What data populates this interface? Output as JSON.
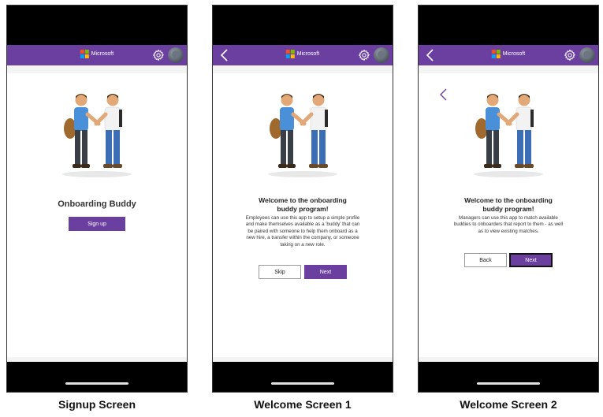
{
  "brand": {
    "name": "Microsoft",
    "logo_colors": [
      "#f25022",
      "#7fba00",
      "#00a4ef",
      "#ffb900"
    ]
  },
  "colors": {
    "header": "#6a3fa0",
    "primary_button": "#6a3fa0"
  },
  "icons": {
    "back": "back-arrow-icon",
    "settings": "gear-icon",
    "profile": "avatar"
  },
  "screens": [
    {
      "caption": "Signup Screen",
      "app_title": "Onboarding Buddy",
      "primary_button": "Sign up"
    },
    {
      "caption": "Welcome Screen 1",
      "title": "Welcome to the onboarding buddy program!",
      "body": "Employees can use this app to setup a simple profile and make themselves available as a 'buddy' that can be paired with someone to help them onboard as a new hire, a transfer within the company, or someone taking on a new role.",
      "secondary_button": "Skip",
      "primary_button": "Next"
    },
    {
      "caption": "Welcome Screen 2",
      "title": "Welcome to the onboarding buddy program!",
      "body": "Managers can use this app to match available buddies to onboarders that report to them - as well as to view existing matches.",
      "secondary_button": "Back",
      "primary_button": "Next"
    }
  ]
}
